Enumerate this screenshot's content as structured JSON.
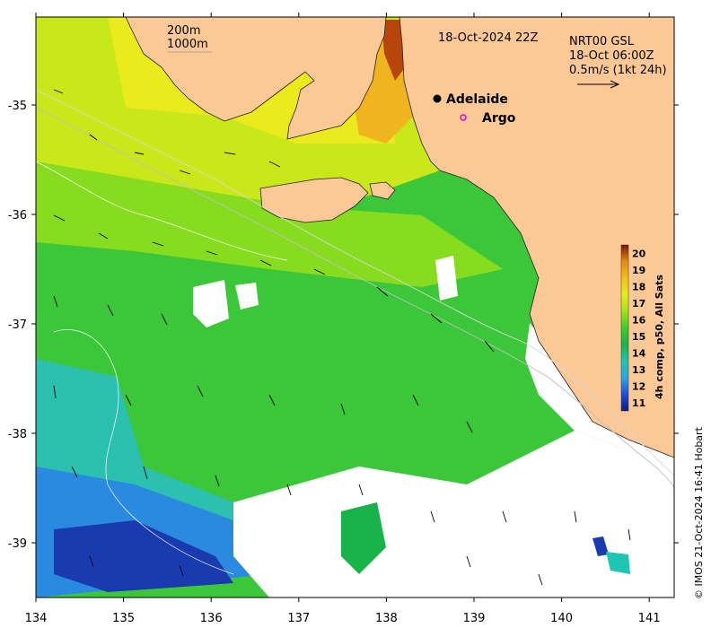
{
  "chart_data": {
    "type": "heatmap",
    "title": "18-Oct-2024 22Z",
    "x_ticks": [
      "134",
      "135",
      "136",
      "137",
      "138",
      "139",
      "140",
      "141"
    ],
    "y_ticks": [
      "-35",
      "-36",
      "-37",
      "-38",
      "-39"
    ],
    "xlim": [
      134,
      141.3
    ],
    "ylim": [
      -39.5,
      -34.2
    ],
    "colorbar": {
      "label": "4h comp, p50, All Sats",
      "ticks": [
        "20",
        "19",
        "18",
        "17",
        "16",
        "15",
        "14",
        "13",
        "12",
        "11"
      ],
      "range": [
        10.5,
        20.5
      ],
      "colors": [
        "#0a1a8c",
        "#1f4fd6",
        "#2aa7e6",
        "#1fc6b4",
        "#17b34a",
        "#3ccf2a",
        "#9ee21a",
        "#e6ee1a",
        "#f0c21a",
        "#e58a14",
        "#b3400a",
        "#7a1404"
      ]
    },
    "depth_legend": [
      "200m",
      "1000m"
    ],
    "current_legend": {
      "line1": "NRT00 GSL",
      "line2": "18-Oct 06:00Z",
      "line3": "0.5m/s (1kt 24h)"
    },
    "places": [
      {
        "name": "Adelaide",
        "lon": 138.6,
        "lat": -34.93,
        "marker": "filled-dot"
      },
      {
        "name": "Argo",
        "lon": 138.85,
        "lat": -35.12,
        "marker": "magenta-ring"
      }
    ]
  },
  "colors": {
    "land": "#fcc996",
    "no_data": "#ffffff"
  },
  "credit": "© IMOS 21-Oct-2024 16:41 Hobart"
}
